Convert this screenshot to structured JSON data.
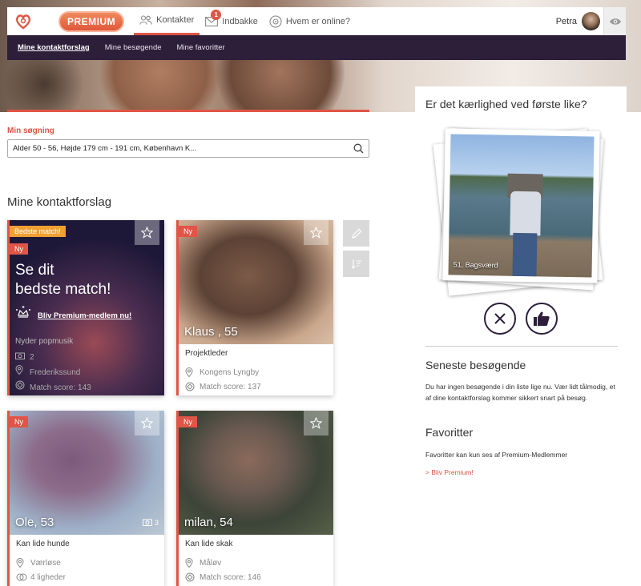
{
  "nav": {
    "premium": "PREMIUM",
    "contacts": "Kontakter",
    "inbox": "Indbakke",
    "inbox_badge": "1",
    "online": "Hvem er online?",
    "user": "Petra"
  },
  "subnav": [
    "Mine kontaktforslag",
    "Mine besøgende",
    "Mine favoritter"
  ],
  "search": {
    "label": "Min søgning",
    "value": "Alder 50 - 56, Højde 179 cm - 191 cm, København K..."
  },
  "section_title": "Mine kontaktforslag",
  "promo_card": {
    "badge": "Bedste match!",
    "tag": "Ny",
    "headline_1": "Se dit",
    "headline_2": "bedste match!",
    "cta": "Bliv Premium-medlem nu!",
    "interest": "Nyder popmusik",
    "photos": "2",
    "location": "Frederikssund",
    "match": "Match score: 143"
  },
  "cards": [
    {
      "tag": "Ny",
      "name": "Klaus , 55",
      "occ": "Projektleder",
      "location": "Kongens Lyngby",
      "extra": "Match score: 137"
    },
    {
      "tag": "Ny",
      "name": "Ole, 53",
      "occ": "Kan lide hunde",
      "location": "Værløse",
      "extra": "4 ligheder",
      "photos": "3"
    },
    {
      "tag": "Ny",
      "name": "milan, 54",
      "occ": "Kan lide skak",
      "location": "Måløv",
      "extra": "Match score: 146"
    }
  ],
  "panel": {
    "question": "Er det kærlighed ved første like?",
    "photo_caption": "51, Bagsværd",
    "visitors_title": "Seneste besøgende",
    "visitors_text": "Du har ingen besøgende i din liste lige nu. Vær lidt tålmodig, et af dine kontaktforslag kommer sikkert snart på besøg.",
    "fav_title": "Favoritter",
    "fav_text": "Favoritter kan kun ses af Premium-Medlemmer",
    "fav_link": "> Bliv Premium!"
  },
  "colors": {
    "accent": "#e05546",
    "nav_dark": "#2d1e3a",
    "premium_tag": "#f0a032"
  }
}
